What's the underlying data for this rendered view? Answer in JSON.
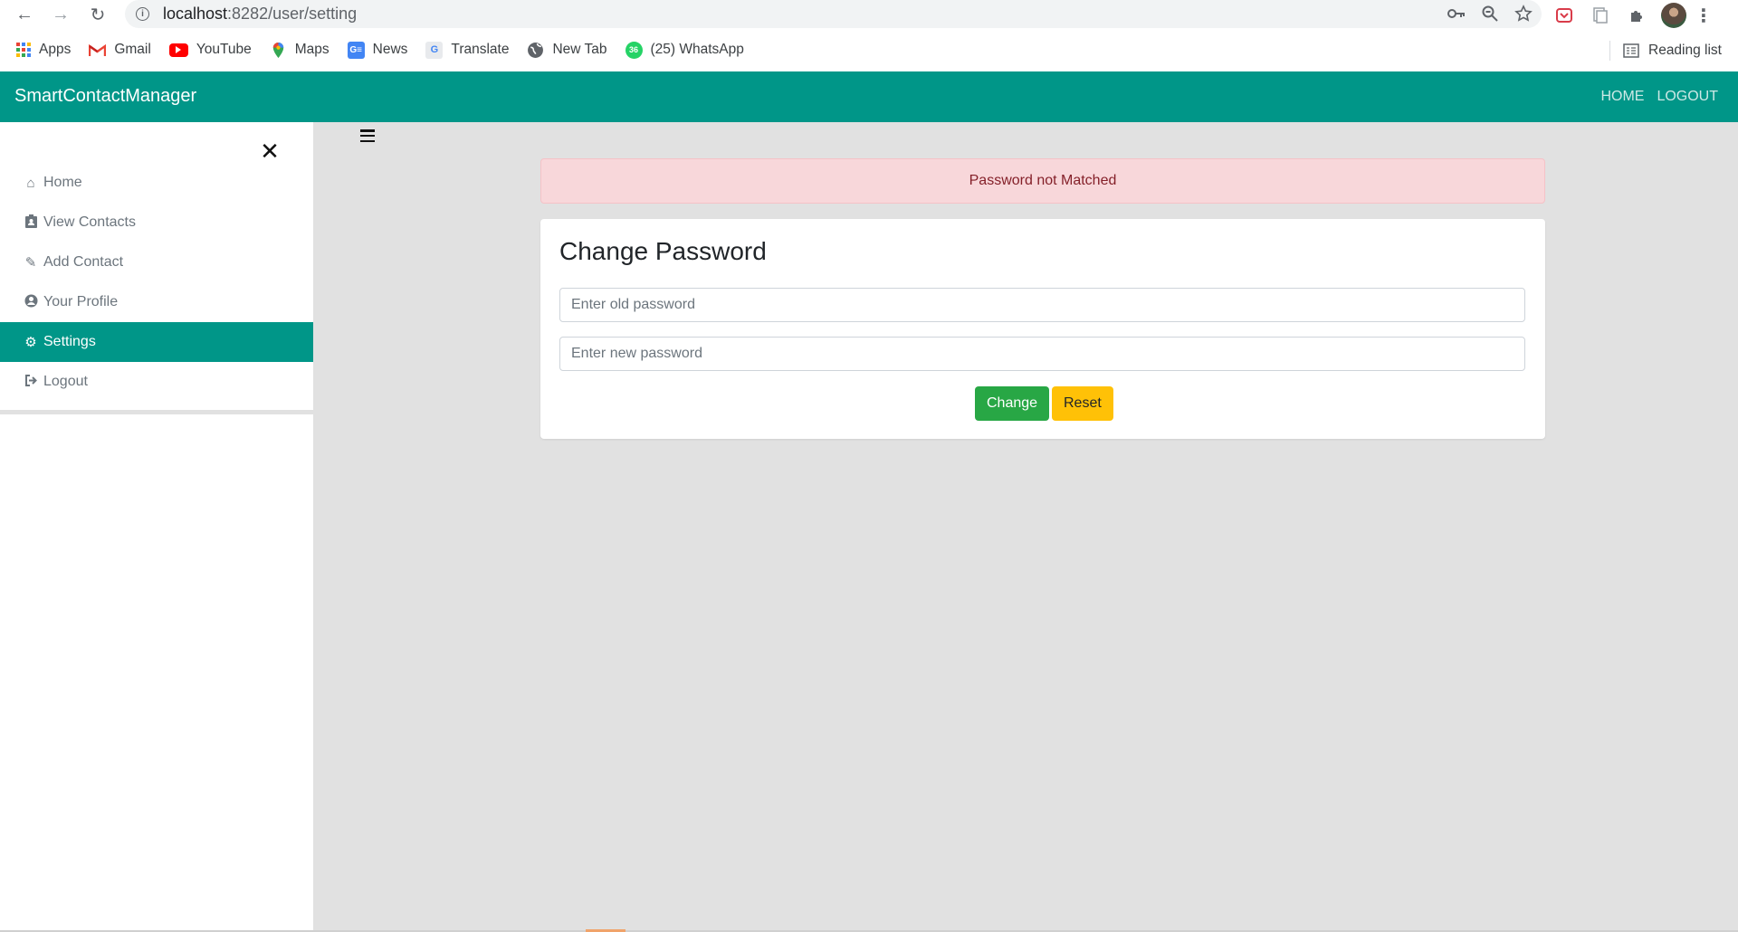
{
  "browser": {
    "url_host": "localhost",
    "url_rest": ":8282/user/setting",
    "bookmarks": [
      {
        "label": "Apps",
        "icon": "apps-grid-icon"
      },
      {
        "label": "Gmail",
        "icon": "gmail-icon"
      },
      {
        "label": "YouTube",
        "icon": "youtube-icon"
      },
      {
        "label": "Maps",
        "icon": "maps-pin-icon"
      },
      {
        "label": "News",
        "icon": "google-news-icon"
      },
      {
        "label": "Translate",
        "icon": "google-translate-icon"
      },
      {
        "label": "New Tab",
        "icon": "globe-icon"
      },
      {
        "label": "(25) WhatsApp",
        "icon": "whatsapp-badge-icon",
        "badge": "36"
      }
    ],
    "reading_list": "Reading list"
  },
  "navbar": {
    "brand": "SmartContactManager",
    "links": [
      "HOME",
      "LOGOUT"
    ],
    "color": "#009688"
  },
  "sidebar": {
    "items": [
      {
        "label": "Home",
        "icon": "home-icon"
      },
      {
        "label": "View Contacts",
        "icon": "contact-card-icon"
      },
      {
        "label": "Add Contact",
        "icon": "pencil-icon"
      },
      {
        "label": "Your Profile",
        "icon": "user-circle-icon"
      },
      {
        "label": "Settings",
        "icon": "cogs-icon",
        "active": true
      },
      {
        "label": "Logout",
        "icon": "sign-out-icon"
      }
    ]
  },
  "alert": {
    "message": "Password not Matched",
    "color": "#f8d7da"
  },
  "form": {
    "title": "Change Password",
    "old_placeholder": "Enter old password",
    "new_placeholder": "Enter new password",
    "change_label": "Change",
    "reset_label": "Reset",
    "change_color": "#28a745",
    "reset_color": "#ffc107"
  }
}
